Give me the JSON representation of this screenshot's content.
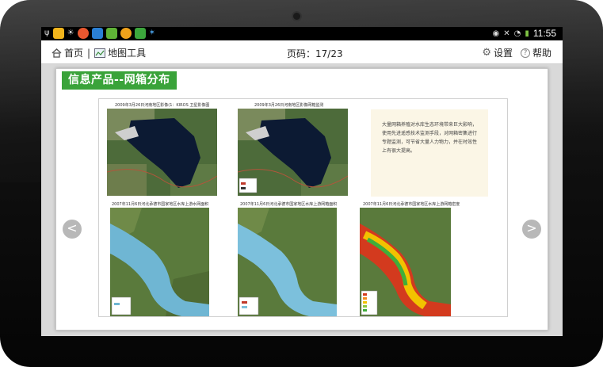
{
  "toolbar": {
    "home_label": "首页",
    "separator": "|",
    "map_tools_label": "地图工具",
    "page_label": "页码：17/23",
    "settings_label": "设置",
    "help_label": "帮助"
  },
  "status": {
    "time": "11:55"
  },
  "content": {
    "title": "信息产品--网箱分布",
    "prev_glyph": "<",
    "next_glyph": ">"
  },
  "slide": {
    "captions": [
      "2009年3月26日河南地区影像(1：KIROS  卫星影像图",
      "2009年3月26日河南地区影像网箱监测",
      "2007年11月6日河北承德市国家地区水库上游水网面积",
      "2007年11月6日河北承德市国家地区水库上游网箱面积",
      "2007年11月6日河北承德市国家地区水库上游网箱密度"
    ],
    "text": "大量网箱养殖对水库生态环境带来巨大影响，使用先进遥感技术监测手段，对网箱密集进行专题监测，可节省大量人力物力，并在时效性上有很大提高。"
  },
  "colors": {
    "title_green": "#3aa33a",
    "water_blue": "#6fb6d3",
    "lake_dark": "#0c1a33"
  }
}
